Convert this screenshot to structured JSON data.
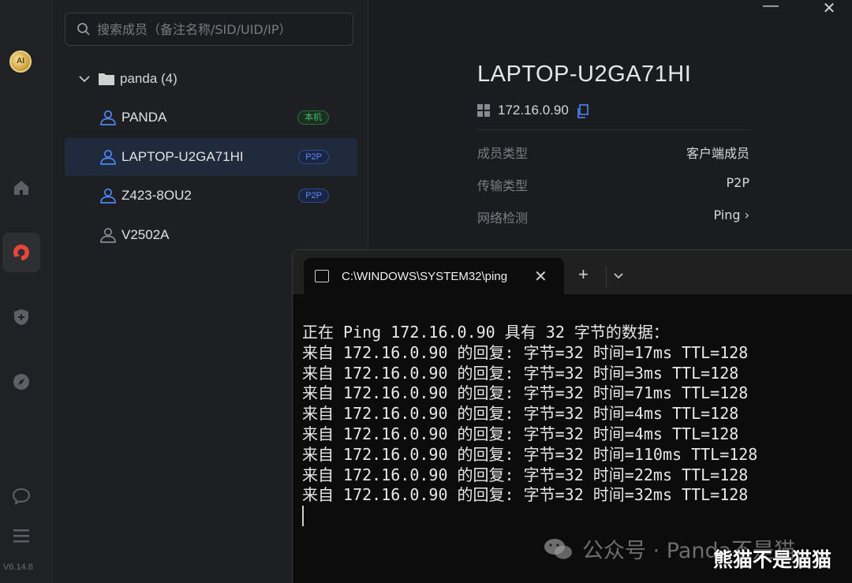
{
  "rail": {
    "avatar_text": "AI",
    "items": [
      {
        "icon": "home-icon"
      },
      {
        "icon": "network-icon",
        "active": true
      },
      {
        "icon": "shield-plus-icon"
      },
      {
        "icon": "compass-icon"
      },
      {
        "icon": "chat-icon"
      },
      {
        "icon": "menu-icon"
      }
    ],
    "version": "V6.14.8",
    "accent": "#e8453c"
  },
  "search": {
    "placeholder": "搜索成员（备注名称/SID/UID/IP）"
  },
  "group": {
    "label": "panda (4)"
  },
  "members": [
    {
      "name": "PANDA",
      "badge": "本机",
      "badge_type": "self",
      "online": true
    },
    {
      "name": "LAPTOP-U2GA71HI",
      "badge": "P2P",
      "badge_type": "p2p",
      "online": true,
      "selected": true
    },
    {
      "name": "Z423-8OU2",
      "badge": "P2P",
      "badge_type": "p2p",
      "online": true
    },
    {
      "name": "V2502A",
      "badge": "",
      "badge_type": "",
      "online": false
    }
  ],
  "detail": {
    "title": "LAPTOP-U2GA71HI",
    "ip": "172.16.0.90",
    "rows": [
      {
        "key": "成员类型",
        "value": "客户端成员"
      },
      {
        "key": "传输类型",
        "value": "P2P"
      },
      {
        "key": "网络检测",
        "value": "Ping ›"
      }
    ],
    "window_controls": {
      "minimize": "—",
      "close": "✕"
    }
  },
  "terminal": {
    "tab_title": "C:\\WINDOWS\\SYSTEM32\\ping",
    "tab_close": "✕",
    "new_tab": "+",
    "dropdown": "⌄",
    "lines": [
      "正在 Ping 172.16.0.90 具有 32 字节的数据：",
      "来自 172.16.0.90 的回复: 字节=32 时间=17ms TTL=128",
      "来自 172.16.0.90 的回复: 字节=32 时间=3ms TTL=128",
      "来自 172.16.0.90 的回复: 字节=32 时间=71ms TTL=128",
      "来自 172.16.0.90 的回复: 字节=32 时间=4ms TTL=128",
      "来自 172.16.0.90 的回复: 字节=32 时间=4ms TTL=128",
      "来自 172.16.0.90 的回复: 字节=32 时间=110ms TTL=128",
      "来自 172.16.0.90 的回复: 字节=32 时间=22ms TTL=128",
      "来自 172.16.0.90 的回复: 字节=32 时间=32ms TTL=128"
    ]
  },
  "watermark": {
    "text": "公众号 · Panda不是猫",
    "overlay": "熊猫不是猫猫"
  }
}
